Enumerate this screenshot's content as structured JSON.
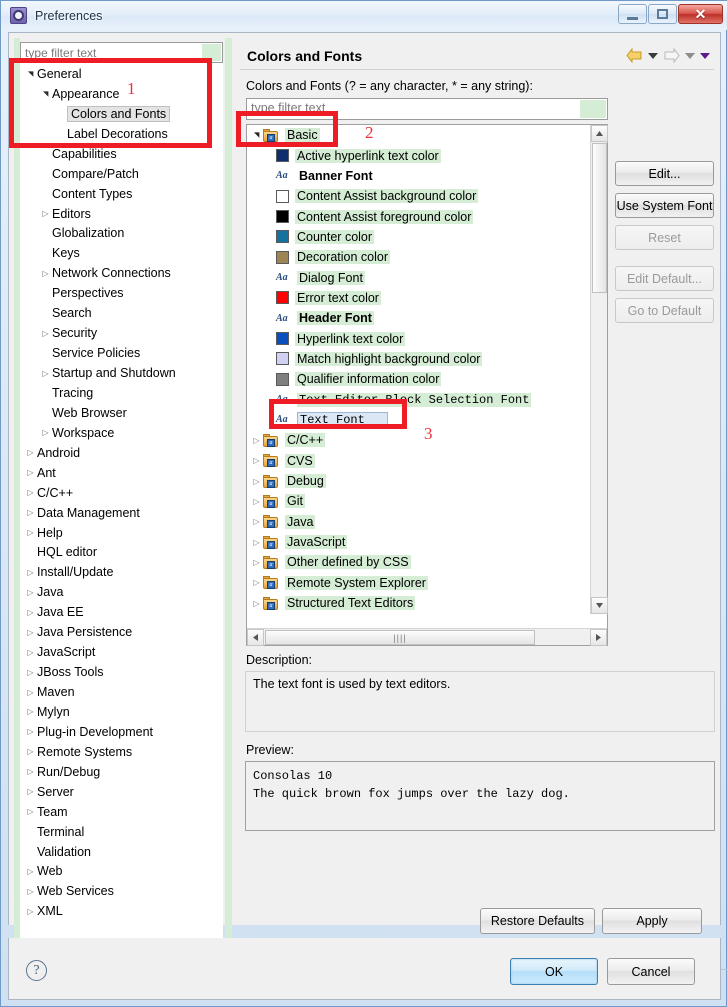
{
  "window": {
    "title": "Preferences",
    "icon": "preferences-gear-icon",
    "buttons": {
      "minimize": "minimize-icon",
      "maximize": "maximize-icon",
      "close": "close-icon"
    }
  },
  "left_panel": {
    "filter_placeholder": "type filter text",
    "tree": [
      {
        "label": "General",
        "indent": 0,
        "arrow": "open",
        "selected": false
      },
      {
        "label": "Appearance",
        "indent": 1,
        "arrow": "open",
        "selected": false
      },
      {
        "label": "Colors and Fonts",
        "indent": 2,
        "arrow": "none",
        "selected": true
      },
      {
        "label": "Label Decorations",
        "indent": 2,
        "arrow": "none",
        "selected": false
      },
      {
        "label": "Capabilities",
        "indent": 1,
        "arrow": "none",
        "selected": false
      },
      {
        "label": "Compare/Patch",
        "indent": 1,
        "arrow": "none",
        "selected": false
      },
      {
        "label": "Content Types",
        "indent": 1,
        "arrow": "none",
        "selected": false
      },
      {
        "label": "Editors",
        "indent": 1,
        "arrow": "closed",
        "selected": false
      },
      {
        "label": "Globalization",
        "indent": 1,
        "arrow": "none",
        "selected": false
      },
      {
        "label": "Keys",
        "indent": 1,
        "arrow": "none",
        "selected": false
      },
      {
        "label": "Network Connections",
        "indent": 1,
        "arrow": "closed",
        "selected": false
      },
      {
        "label": "Perspectives",
        "indent": 1,
        "arrow": "none",
        "selected": false
      },
      {
        "label": "Search",
        "indent": 1,
        "arrow": "none",
        "selected": false
      },
      {
        "label": "Security",
        "indent": 1,
        "arrow": "closed",
        "selected": false
      },
      {
        "label": "Service Policies",
        "indent": 1,
        "arrow": "none",
        "selected": false
      },
      {
        "label": "Startup and Shutdown",
        "indent": 1,
        "arrow": "closed",
        "selected": false
      },
      {
        "label": "Tracing",
        "indent": 1,
        "arrow": "none",
        "selected": false
      },
      {
        "label": "Web Browser",
        "indent": 1,
        "arrow": "none",
        "selected": false
      },
      {
        "label": "Workspace",
        "indent": 1,
        "arrow": "closed",
        "selected": false
      },
      {
        "label": "Android",
        "indent": 0,
        "arrow": "closed",
        "selected": false
      },
      {
        "label": "Ant",
        "indent": 0,
        "arrow": "closed",
        "selected": false
      },
      {
        "label": "C/C++",
        "indent": 0,
        "arrow": "closed",
        "selected": false
      },
      {
        "label": "Data Management",
        "indent": 0,
        "arrow": "closed",
        "selected": false
      },
      {
        "label": "Help",
        "indent": 0,
        "arrow": "closed",
        "selected": false
      },
      {
        "label": "HQL editor",
        "indent": 0,
        "arrow": "none",
        "selected": false
      },
      {
        "label": "Install/Update",
        "indent": 0,
        "arrow": "closed",
        "selected": false
      },
      {
        "label": "Java",
        "indent": 0,
        "arrow": "closed",
        "selected": false
      },
      {
        "label": "Java EE",
        "indent": 0,
        "arrow": "closed",
        "selected": false
      },
      {
        "label": "Java Persistence",
        "indent": 0,
        "arrow": "closed",
        "selected": false
      },
      {
        "label": "JavaScript",
        "indent": 0,
        "arrow": "closed",
        "selected": false
      },
      {
        "label": "JBoss Tools",
        "indent": 0,
        "arrow": "closed",
        "selected": false
      },
      {
        "label": "Maven",
        "indent": 0,
        "arrow": "closed",
        "selected": false
      },
      {
        "label": "Mylyn",
        "indent": 0,
        "arrow": "closed",
        "selected": false
      },
      {
        "label": "Plug-in Development",
        "indent": 0,
        "arrow": "closed",
        "selected": false
      },
      {
        "label": "Remote Systems",
        "indent": 0,
        "arrow": "closed",
        "selected": false
      },
      {
        "label": "Run/Debug",
        "indent": 0,
        "arrow": "closed",
        "selected": false
      },
      {
        "label": "Server",
        "indent": 0,
        "arrow": "closed",
        "selected": false
      },
      {
        "label": "Team",
        "indent": 0,
        "arrow": "closed",
        "selected": false
      },
      {
        "label": "Terminal",
        "indent": 0,
        "arrow": "none",
        "selected": false
      },
      {
        "label": "Validation",
        "indent": 0,
        "arrow": "none",
        "selected": false
      },
      {
        "label": "Web",
        "indent": 0,
        "arrow": "closed",
        "selected": false
      },
      {
        "label": "Web Services",
        "indent": 0,
        "arrow": "closed",
        "selected": false
      },
      {
        "label": "XML",
        "indent": 0,
        "arrow": "closed",
        "selected": false
      }
    ]
  },
  "right_panel": {
    "page_title": "Colors and Fonts",
    "filter_label": "Colors and Fonts (? = any character, * = any string):",
    "filter_placeholder": "type filter text",
    "nav": {
      "back": "back-arrow-icon",
      "back_menu": "caret-down-icon",
      "forward": "forward-arrow-icon",
      "forward_menu": "caret-down-icon",
      "view_menu": "caret-down-icon"
    },
    "tree": [
      {
        "label": "Basic",
        "kind": "folder",
        "arrow": "open",
        "indent": 0,
        "highlight": true,
        "selected": false,
        "bold": false,
        "mono": false,
        "swatch": ""
      },
      {
        "label": "Active hyperlink text color",
        "kind": "swatch",
        "arrow": "none",
        "indent": 1,
        "highlight": true,
        "selected": false,
        "bold": false,
        "mono": false,
        "swatch": "#0d2f6e"
      },
      {
        "label": "Banner Font",
        "kind": "font",
        "arrow": "none",
        "indent": 1,
        "highlight": false,
        "selected": false,
        "bold": true,
        "mono": false,
        "swatch": ""
      },
      {
        "label": "Content Assist background color",
        "kind": "swatch",
        "arrow": "none",
        "indent": 1,
        "highlight": true,
        "selected": false,
        "bold": false,
        "mono": false,
        "swatch": "#ffffff"
      },
      {
        "label": "Content Assist foreground color",
        "kind": "swatch",
        "arrow": "none",
        "indent": 1,
        "highlight": true,
        "selected": false,
        "bold": false,
        "mono": false,
        "swatch": "#000000"
      },
      {
        "label": "Counter color",
        "kind": "swatch",
        "arrow": "none",
        "indent": 1,
        "highlight": true,
        "selected": false,
        "bold": false,
        "mono": false,
        "swatch": "#15719e"
      },
      {
        "label": "Decoration color",
        "kind": "swatch",
        "arrow": "none",
        "indent": 1,
        "highlight": true,
        "selected": false,
        "bold": false,
        "mono": false,
        "swatch": "#9d8654"
      },
      {
        "label": "Dialog Font",
        "kind": "font",
        "arrow": "none",
        "indent": 1,
        "highlight": true,
        "selected": false,
        "bold": false,
        "mono": false,
        "swatch": ""
      },
      {
        "label": "Error text color",
        "kind": "swatch",
        "arrow": "none",
        "indent": 1,
        "highlight": true,
        "selected": false,
        "bold": false,
        "mono": false,
        "swatch": "#fe0000"
      },
      {
        "label": "Header Font",
        "kind": "font",
        "arrow": "none",
        "indent": 1,
        "highlight": true,
        "selected": false,
        "bold": true,
        "mono": false,
        "swatch": ""
      },
      {
        "label": "Hyperlink text color",
        "kind": "swatch",
        "arrow": "none",
        "indent": 1,
        "highlight": true,
        "selected": false,
        "bold": false,
        "mono": false,
        "swatch": "#0a4fbe"
      },
      {
        "label": "Match highlight background color",
        "kind": "swatch",
        "arrow": "none",
        "indent": 1,
        "highlight": true,
        "selected": false,
        "bold": false,
        "mono": false,
        "swatch": "#cfd0f2"
      },
      {
        "label": "Qualifier information color",
        "kind": "swatch",
        "arrow": "none",
        "indent": 1,
        "highlight": true,
        "selected": false,
        "bold": false,
        "mono": false,
        "swatch": "#7f7f7f"
      },
      {
        "label": "Text Editor Block Selection Font",
        "kind": "font",
        "arrow": "none",
        "indent": 1,
        "highlight": true,
        "selected": false,
        "bold": false,
        "mono": true,
        "swatch": ""
      },
      {
        "label": "Text Font",
        "kind": "font",
        "arrow": "none",
        "indent": 1,
        "highlight": false,
        "selected": true,
        "bold": false,
        "mono": true,
        "swatch": ""
      },
      {
        "label": "C/C++",
        "kind": "folder",
        "arrow": "closed",
        "indent": 0,
        "highlight": true,
        "selected": false,
        "bold": false,
        "mono": false,
        "swatch": ""
      },
      {
        "label": "CVS",
        "kind": "folder",
        "arrow": "closed",
        "indent": 0,
        "highlight": true,
        "selected": false,
        "bold": false,
        "mono": false,
        "swatch": ""
      },
      {
        "label": "Debug",
        "kind": "folder",
        "arrow": "closed",
        "indent": 0,
        "highlight": true,
        "selected": false,
        "bold": false,
        "mono": false,
        "swatch": ""
      },
      {
        "label": "Git",
        "kind": "folder",
        "arrow": "closed",
        "indent": 0,
        "highlight": true,
        "selected": false,
        "bold": false,
        "mono": false,
        "swatch": ""
      },
      {
        "label": "Java",
        "kind": "folder",
        "arrow": "closed",
        "indent": 0,
        "highlight": true,
        "selected": false,
        "bold": false,
        "mono": false,
        "swatch": ""
      },
      {
        "label": "JavaScript",
        "kind": "folder",
        "arrow": "closed",
        "indent": 0,
        "highlight": true,
        "selected": false,
        "bold": false,
        "mono": false,
        "swatch": ""
      },
      {
        "label": "Other defined by CSS",
        "kind": "folder",
        "arrow": "closed",
        "indent": 0,
        "highlight": true,
        "selected": false,
        "bold": false,
        "mono": false,
        "swatch": ""
      },
      {
        "label": "Remote System Explorer",
        "kind": "folder",
        "arrow": "closed",
        "indent": 0,
        "highlight": true,
        "selected": false,
        "bold": false,
        "mono": false,
        "swatch": ""
      },
      {
        "label": "Structured Text Editors",
        "kind": "folder",
        "arrow": "closed",
        "indent": 0,
        "highlight": true,
        "selected": false,
        "bold": false,
        "mono": false,
        "swatch": ""
      }
    ],
    "buttons": [
      {
        "label": "Edit...",
        "disabled": false,
        "gap": false
      },
      {
        "label": "Use System Font",
        "disabled": false,
        "gap": false
      },
      {
        "label": "Reset",
        "disabled": true,
        "gap": false
      },
      {
        "label": "Edit Default...",
        "disabled": true,
        "gap": true
      },
      {
        "label": "Go to Default",
        "disabled": true,
        "gap": false
      }
    ],
    "description_label": "Description:",
    "description_text": "The text font is used by text editors.",
    "preview_label": "Preview:",
    "preview_line1": "Consolas 10",
    "preview_line2": "The quick brown fox jumps over the lazy dog."
  },
  "footer": {
    "restore_defaults": "Restore Defaults",
    "apply": "Apply",
    "ok": "OK",
    "cancel": "Cancel",
    "help_icon": "help-question-icon"
  },
  "annotations": [
    {
      "number": "1"
    },
    {
      "number": "2"
    },
    {
      "number": "3"
    }
  ]
}
